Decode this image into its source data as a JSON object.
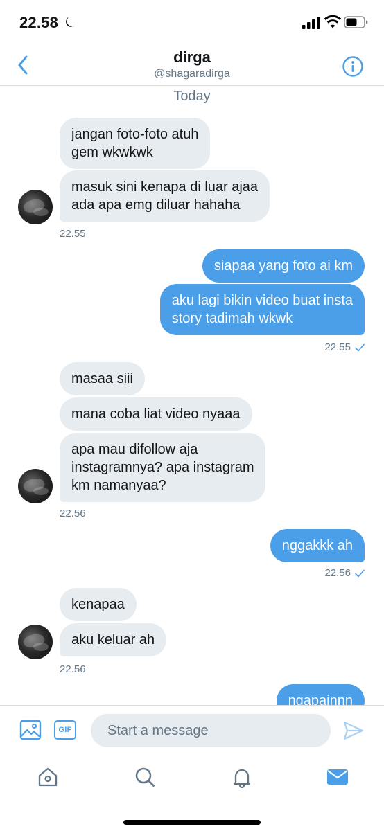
{
  "status_bar": {
    "time": "22.58",
    "icons": [
      "moon-icon",
      "cellular-signal-icon",
      "wifi-icon",
      "battery-icon"
    ]
  },
  "header": {
    "title": "dirga",
    "handle": "@shagaradirga",
    "back_icon": "chevron-left-icon",
    "info_icon": "info-icon"
  },
  "chat": {
    "day_label": "Today",
    "messages": [
      {
        "direction": "in",
        "lines": [
          "jangan foto-foto atuh",
          "gem wkwkwk"
        ]
      },
      {
        "direction": "in",
        "lines": [
          "masuk sini kenapa di luar ajaa",
          "ada apa emg diluar hahaha"
        ]
      },
      {
        "direction": "out",
        "lines": [
          "siapaa yang foto ai km"
        ]
      },
      {
        "direction": "out",
        "lines": [
          "aku lagi bikin video buat insta",
          "story tadimah wkwk"
        ]
      },
      {
        "direction": "in",
        "lines": [
          "masaa siii"
        ]
      },
      {
        "direction": "in",
        "lines": [
          "mana coba liat video nyaaa"
        ]
      },
      {
        "direction": "in",
        "lines": [
          "apa mau difollow aja",
          "instagramnya? apa instagram",
          "km namanyaa?"
        ]
      },
      {
        "direction": "out",
        "lines": [
          "nggakkk ah"
        ]
      },
      {
        "direction": "in",
        "lines": [
          "kenapaa"
        ]
      },
      {
        "direction": "in",
        "lines": [
          "aku keluar ah"
        ]
      },
      {
        "direction": "out",
        "lines": [
          "ngapainnn"
        ]
      }
    ],
    "timestamps": {
      "in_1": "22.55",
      "out_1": "22.55",
      "in_2": "22.56",
      "out_2": "22.56",
      "in_3": "22.56"
    }
  },
  "composer": {
    "placeholder": "Start a message",
    "image_icon": "image-icon",
    "gif_label": "GIF",
    "send_icon": "send-icon"
  },
  "tabbar": {
    "tabs": [
      "home-icon",
      "search-icon",
      "notifications-bell-icon",
      "messages-envelope-icon"
    ],
    "active": "messages-envelope-icon"
  },
  "colors": {
    "accent": "#4a9fe8",
    "incoming_bubble": "#e6ecf0",
    "secondary_text": "#657786"
  }
}
